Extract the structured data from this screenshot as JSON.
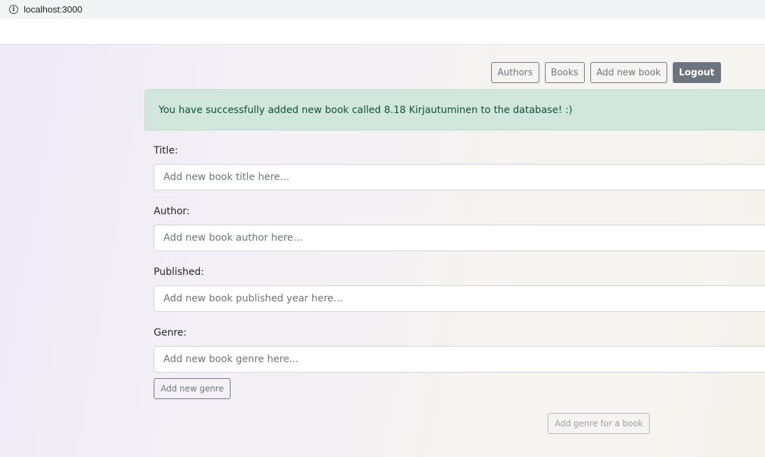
{
  "browser": {
    "url": "localhost:3000",
    "info_icon": "info-icon"
  },
  "nav": {
    "authors": "Authors",
    "books": "Books",
    "add_book": "Add new book",
    "logout": "Logout"
  },
  "alert": {
    "message": "You have successfully added new book called 8.18 Kirjautuminen to the database! :)"
  },
  "form": {
    "title_label": "Title:",
    "title_placeholder": "Add new book title here...",
    "author_label": "Author:",
    "author_placeholder": "Add new book author here...",
    "published_label": "Published:",
    "published_placeholder": "Add new book published year here...",
    "genre_label": "Genre:",
    "genre_placeholder": "Add new book genre here...",
    "add_genre": "Add new genre",
    "submit_genre": "Add genre for a book"
  }
}
